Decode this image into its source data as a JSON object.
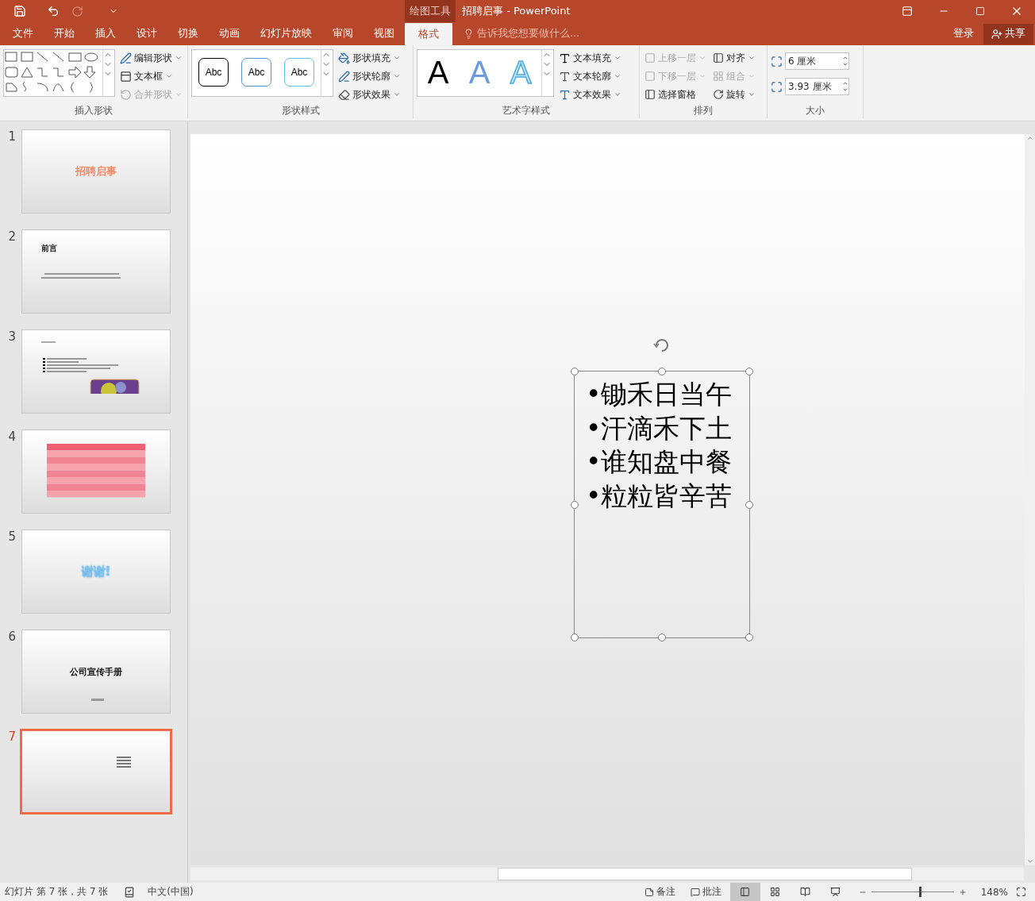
{
  "window": {
    "context_group": "绘图工具",
    "title": "招聘启事 - PowerPoint"
  },
  "tabs": [
    {
      "label": "文件",
      "selected": false
    },
    {
      "label": "开始",
      "selected": false
    },
    {
      "label": "插入",
      "selected": false
    },
    {
      "label": "设计",
      "selected": false
    },
    {
      "label": "切换",
      "selected": false
    },
    {
      "label": "动画",
      "selected": false
    },
    {
      "label": "幻灯片放映",
      "selected": false
    },
    {
      "label": "审阅",
      "selected": false
    },
    {
      "label": "视图",
      "selected": false
    },
    {
      "label": "格式",
      "selected": true
    }
  ],
  "tell_me": {
    "placeholder": "告诉我您想要做什么..."
  },
  "account": {
    "sign_in": "登录",
    "share": "共享"
  },
  "ribbon": {
    "insert_shapes": {
      "label": "插入形状",
      "commands": [
        {
          "label": "编辑形状",
          "disabled": false
        },
        {
          "label": "文本框",
          "disabled": false
        },
        {
          "label": "合并形状",
          "disabled": true
        }
      ]
    },
    "shape_styles": {
      "label": "形状样式",
      "styles": [
        {
          "label": "Abc",
          "kind": "black"
        },
        {
          "label": "Abc",
          "kind": "blue"
        },
        {
          "label": "Abc",
          "kind": "lightblue"
        }
      ],
      "commands": [
        {
          "label": "形状填充",
          "disabled": false
        },
        {
          "label": "形状轮廓",
          "disabled": false
        },
        {
          "label": "形状效果",
          "disabled": false
        }
      ]
    },
    "wordart_styles": {
      "label": "艺术字样式",
      "samples": [
        {
          "label": "A",
          "kind": "black"
        },
        {
          "label": "A",
          "kind": "blue"
        },
        {
          "label": "A",
          "kind": "outline"
        }
      ],
      "commands": [
        {
          "label": "文本填充",
          "disabled": false
        },
        {
          "label": "文本轮廓",
          "disabled": false
        },
        {
          "label": "文本效果",
          "disabled": false
        }
      ]
    },
    "arrange": {
      "label": "排列",
      "commands": [
        {
          "label": "上移一层",
          "disabled": true
        },
        {
          "label": "对齐",
          "disabled": false
        },
        {
          "label": "下移一层",
          "disabled": true
        },
        {
          "label": "组合",
          "disabled": true
        },
        {
          "label": "选择窗格",
          "disabled": false
        },
        {
          "label": "旋转",
          "disabled": false
        }
      ]
    },
    "size": {
      "label": "大小",
      "height": "6 厘米",
      "width": "3.93 厘米"
    }
  },
  "slides": [
    {
      "number": "1",
      "selected": false,
      "kind": "title",
      "title": "招聘启事"
    },
    {
      "number": "2",
      "selected": false,
      "kind": "text",
      "title": "前言"
    },
    {
      "number": "3",
      "selected": false,
      "kind": "bullets"
    },
    {
      "number": "4",
      "selected": false,
      "kind": "table"
    },
    {
      "number": "5",
      "selected": false,
      "kind": "glow",
      "title": "谢谢!"
    },
    {
      "number": "6",
      "selected": false,
      "kind": "centered",
      "title": "公司宣传手册"
    },
    {
      "number": "7",
      "selected": true,
      "kind": "textbox"
    }
  ],
  "editor": {
    "text_lines": [
      "•锄禾日当午",
      "•汗滴禾下土",
      "•谁知盘中餐",
      "•粒粒皆辛苦"
    ]
  },
  "status_bar": {
    "slide_info": "幻灯片 第 7 张，共 7 张",
    "language": "中文(中国)",
    "notes": "备注",
    "comments": "批注",
    "views": [
      {
        "kind": "normal",
        "selected": true
      },
      {
        "kind": "sorter",
        "selected": false
      },
      {
        "kind": "reading",
        "selected": false
      },
      {
        "kind": "slideshow",
        "selected": false
      }
    ],
    "zoom": {
      "level": 0.58,
      "reading": "148%"
    }
  }
}
